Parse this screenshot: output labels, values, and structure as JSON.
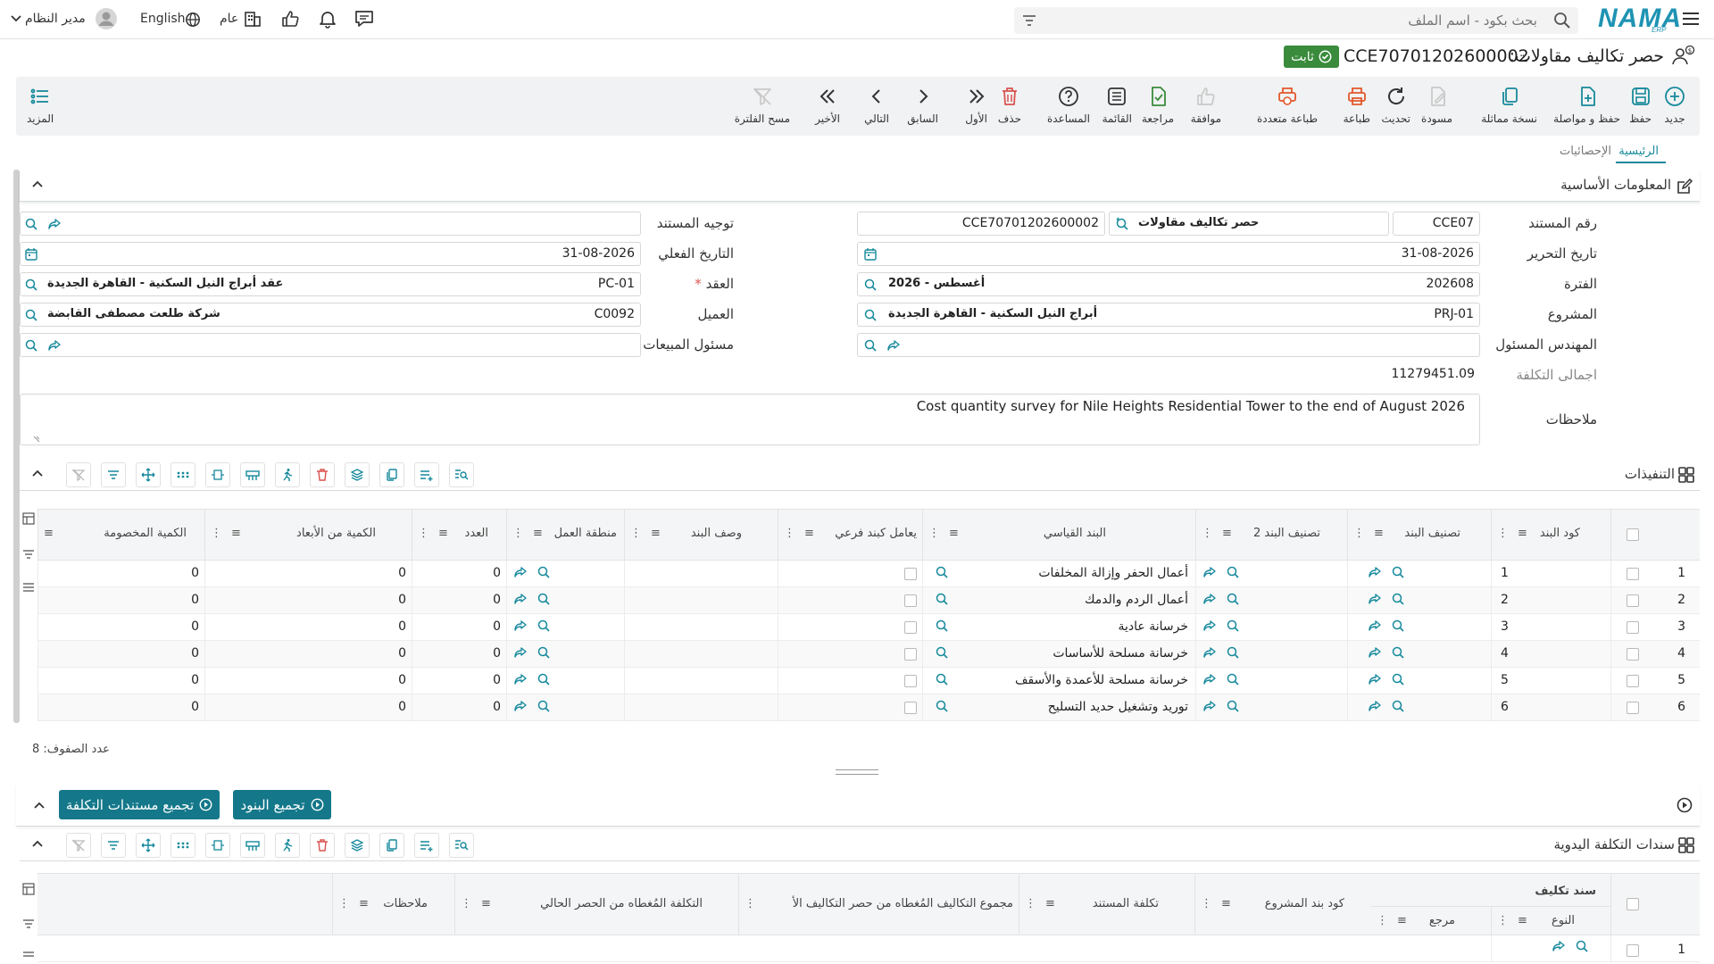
{
  "topbar": {
    "logo": "NAMA",
    "logo_sub": "ERP",
    "search_placeholder": "بحث بكود - اسم الملف",
    "language": "English",
    "branch": "عام",
    "user": "مدير النظام"
  },
  "document": {
    "title": "حصر تكاليف مقاولات:",
    "id": "CCE70701202600002",
    "status": "ثابت"
  },
  "toolbar": {
    "buttons": [
      {
        "label": "جديد",
        "icon": "plus-circle-icon"
      },
      {
        "label": "حفظ",
        "icon": "save-icon"
      },
      {
        "label": "حفظ و مواصلة",
        "icon": "save-continue-icon"
      },
      {
        "label": "نسخة مماثلة",
        "icon": "copy-icon"
      },
      {
        "label": "مسودة",
        "icon": "draft-icon"
      },
      {
        "label": "تحديث",
        "icon": "refresh-icon"
      },
      {
        "label": "طباعة",
        "icon": "print-icon"
      },
      {
        "label": "طباعة متعددة",
        "icon": "multi-print-icon"
      },
      {
        "label": "موافقة",
        "icon": "thumbs-up-icon"
      },
      {
        "label": "مراجعة",
        "icon": "review-icon"
      },
      {
        "label": "القائمة",
        "icon": "list-icon"
      },
      {
        "label": "المساعدة",
        "icon": "help-icon"
      },
      {
        "label": "حذف",
        "icon": "trash-icon"
      },
      {
        "label": "الأول",
        "icon": "first-icon"
      },
      {
        "label": "السابق",
        "icon": "previous-icon"
      },
      {
        "label": "التالي",
        "icon": "next-icon"
      },
      {
        "label": "الأخير",
        "icon": "last-icon"
      },
      {
        "label": "مسح الفلترة",
        "icon": "clear-filter-icon"
      }
    ],
    "more": "المزيد"
  },
  "tabs": [
    "الرئيسية",
    "الإحصائيات"
  ],
  "basic_info": {
    "title": "المعلومات الأساسية",
    "doc_no_label": "رقم المستند",
    "doc_no_code": "CCE07",
    "doc_no_type": "حصر تكاليف مقاولات",
    "doc_no_full": "CCE70701202600002",
    "direction_label": "توجيه المستند",
    "edit_date_label": "تاريخ التحرير",
    "edit_date": "31-08-2026",
    "actual_date_label": "التاريخ الفعلي",
    "actual_date": "31-08-2026",
    "period_label": "الفترة",
    "period_code": "202608",
    "period_name": "2026 - أغسطس",
    "contract_label": "العقد",
    "contract_code": "PC-01",
    "contract_name": "عقد أبراج النيل السكنية - القاهرة الجديدة",
    "project_label": "المشروع",
    "project_code": "PRJ-01",
    "project_name": "أبراج النيل السكنية - القاهرة الجديدة",
    "customer_label": "العميل",
    "customer_code": "C0092",
    "customer_name": "شركة طلعت مصطفى القابضة",
    "engineer_label": "المهندس المسئول",
    "sales_label": "مسئول المبيعات",
    "total_cost_label": "اجمالى التكلفة",
    "total_cost": "11279451.09",
    "notes_label": "ملاحظات",
    "notes": "Cost quantity survey for Nile Heights Residential Tower to the end of August 2026"
  },
  "executions": {
    "title": "التنفيذات",
    "columns": [
      "كود البند",
      "تصنيف البند",
      "تصنيف البند 2",
      "البند القياسي",
      "يعامل كبند فرعي",
      "وصف البند",
      "منطقة العمل",
      "العدد",
      "الكمية من الأبعاد",
      "الكمية المخصومة"
    ],
    "rows": [
      {
        "n": "1",
        "code": "1",
        "item": "أعمال الحفر وإزالة المخلفات",
        "count": "0",
        "qty_dim": "0",
        "qty_ded": "0"
      },
      {
        "n": "2",
        "code": "2",
        "item": "أعمال الردم والدمك",
        "count": "0",
        "qty_dim": "0",
        "qty_ded": "0"
      },
      {
        "n": "3",
        "code": "3",
        "item": "خرسانة عادية",
        "count": "0",
        "qty_dim": "0",
        "qty_ded": "0"
      },
      {
        "n": "4",
        "code": "4",
        "item": "خرسانة مسلحة للأساسات",
        "count": "0",
        "qty_dim": "0",
        "qty_ded": "0"
      },
      {
        "n": "5",
        "code": "5",
        "item": "خرسانة مسلحة للأعمدة والأسقف",
        "count": "0",
        "qty_dim": "0",
        "qty_ded": "0"
      },
      {
        "n": "6",
        "code": "6",
        "item": "توريد وتشغيل حديد التسليح",
        "count": "0",
        "qty_dim": "0",
        "qty_ded": "0"
      }
    ],
    "row_count": "عدد الصفوف: 8"
  },
  "actions": {
    "collect_items": "تجميع البنود",
    "collect_cost_docs": "تجميع مستندات التكلفة"
  },
  "manual_cost": {
    "title": "سندات التكلفة اليدوية",
    "group_header": "سند تكليف",
    "columns": [
      "النوع",
      "مرجع",
      "كود بند المشروع",
      "تكلفة المستند",
      "مجموع التكاليف المُغطاه من حصر التكاليف الأ",
      "التكلفة المُغطاه من الحصر الحالي",
      "ملاحظات"
    ],
    "rows": [
      {
        "n": "1"
      }
    ]
  }
}
